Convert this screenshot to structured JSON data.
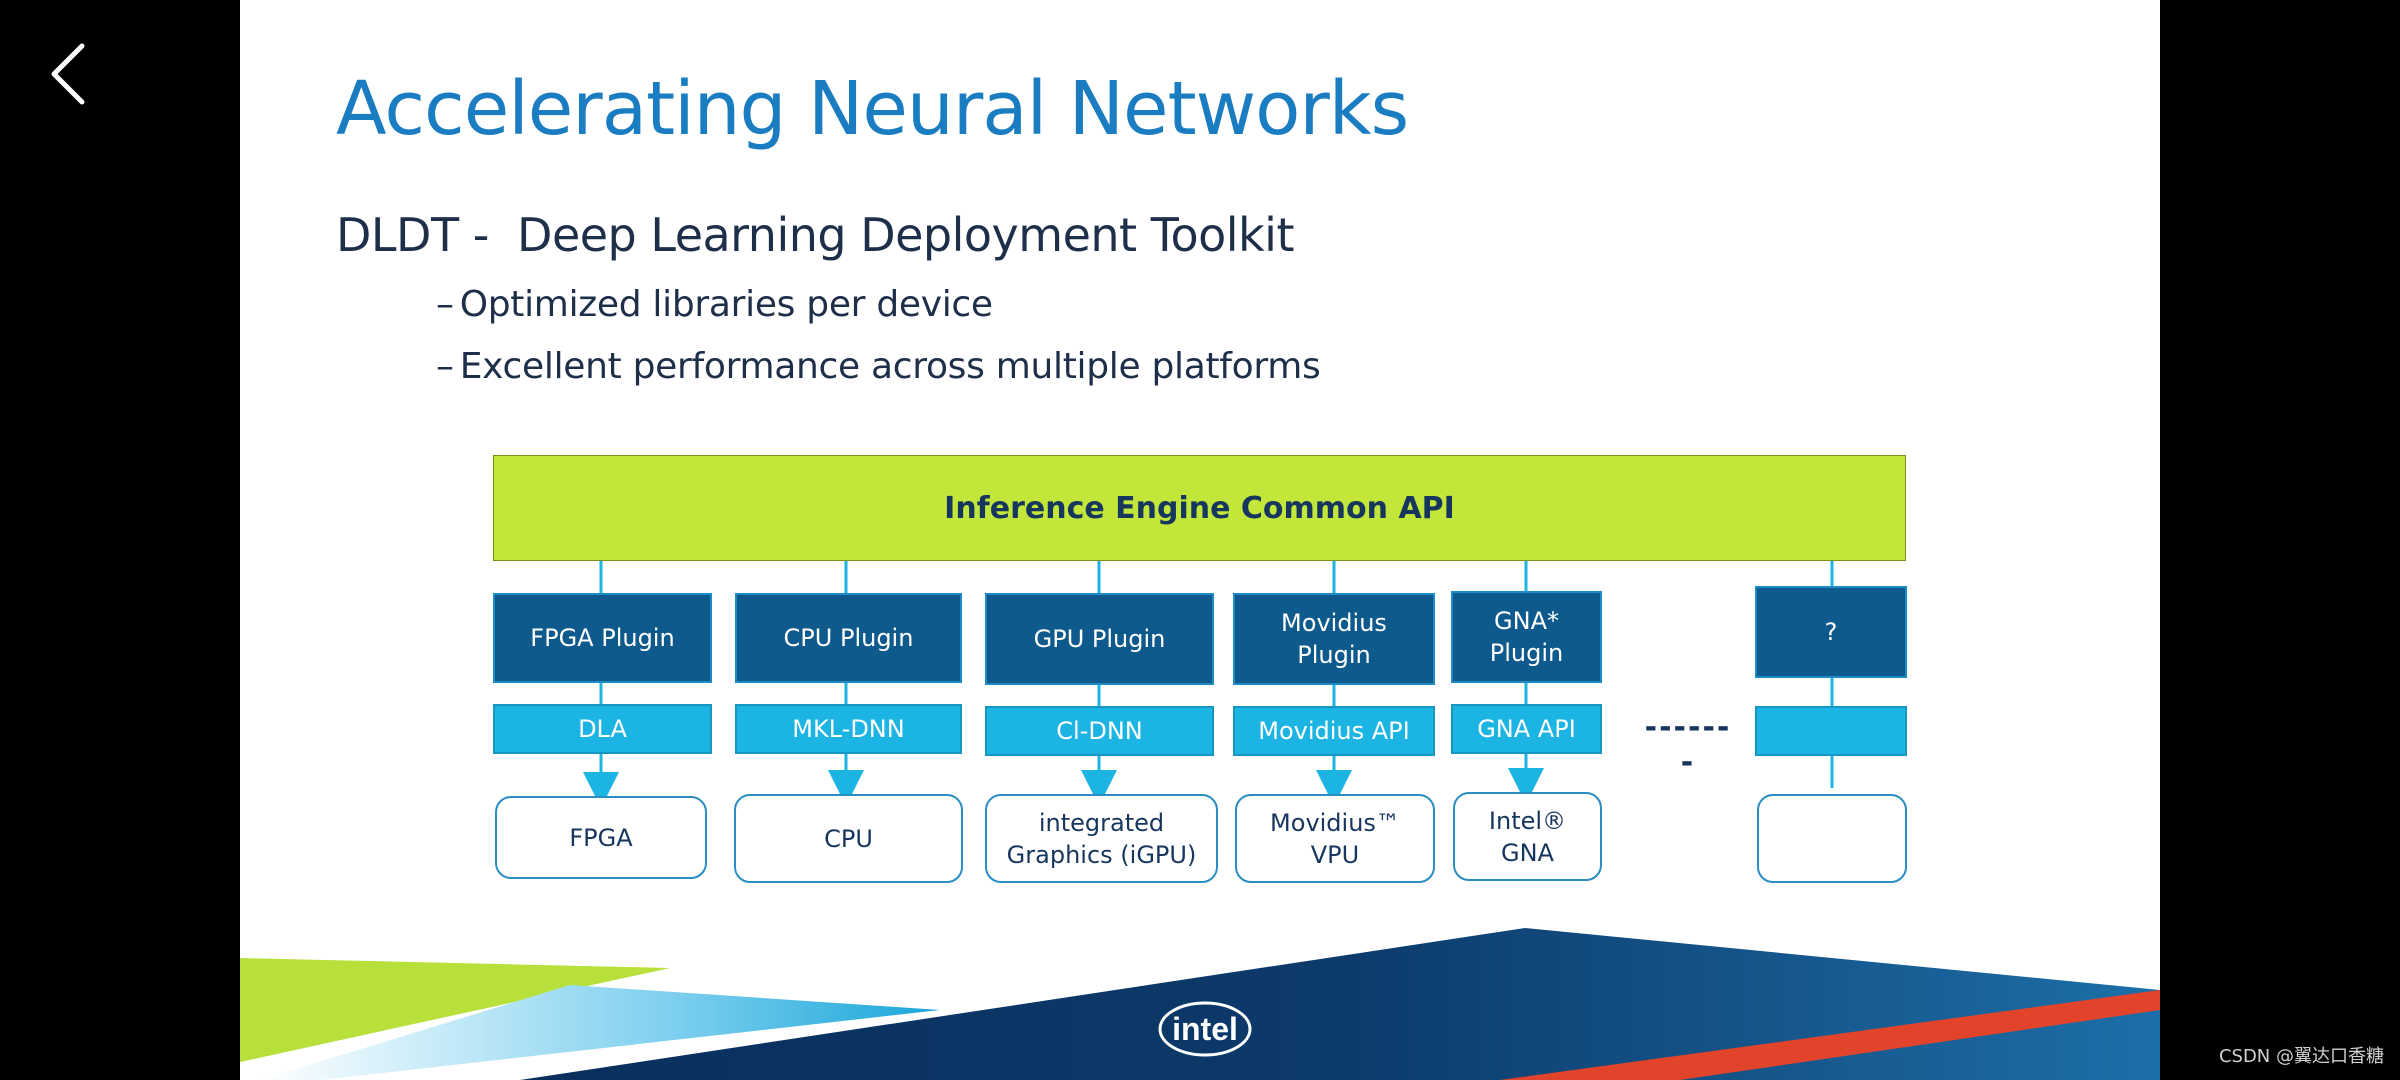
{
  "nav": {
    "back_icon": "chevron-left-icon"
  },
  "slide": {
    "title": "Accelerating Neural Networks",
    "subtitle": "DLDT -  Deep Learning Deployment Toolkit",
    "bullets": [
      "Optimized libraries per device",
      "Excellent performance across multiple platforms"
    ],
    "bullet_marker": "–"
  },
  "diagram": {
    "api_label": "Inference Engine Common API",
    "columns": [
      {
        "plugin": "FPGA Plugin",
        "library": "DLA",
        "device": "FPGA"
      },
      {
        "plugin": "CPU Plugin",
        "library": "MKL-DNN",
        "device": "CPU"
      },
      {
        "plugin": "GPU Plugin",
        "library": "Cl-DNN",
        "device": "integrated\nGraphics (iGPU)"
      },
      {
        "plugin": "Movidius\nPlugin",
        "library": "Movidius API",
        "device": "Movidius™\nVPU"
      },
      {
        "plugin": "GNA*\nPlugin",
        "library": "GNA API",
        "device": "Intel®\nGNA"
      },
      {
        "plugin": "?",
        "library": "",
        "device": ""
      }
    ],
    "ellipsis": "-------"
  },
  "branding": {
    "logo_text": "intel"
  },
  "watermark": "CSDN @翼达口香糖",
  "colors": {
    "title_blue": "#1a7cc1",
    "api_green": "#c3e63b",
    "plugin_navy": "#0f5a8c",
    "library_cyan": "#1cb4e3",
    "footer_red": "#e2432b"
  }
}
